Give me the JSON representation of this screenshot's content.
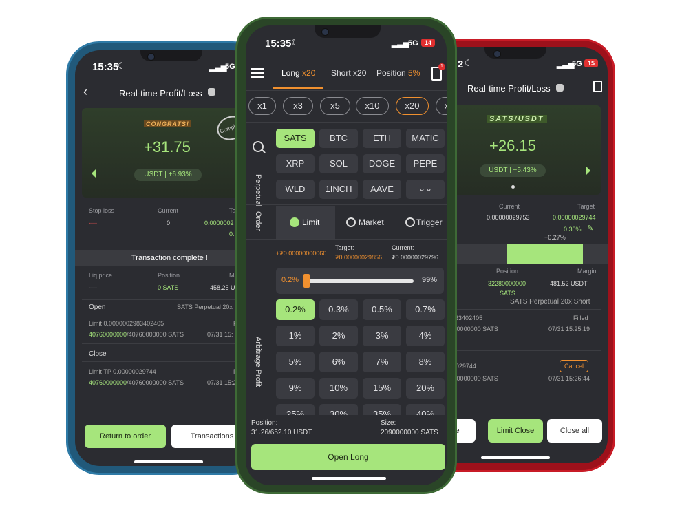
{
  "left": {
    "time": "15:35",
    "signal": "5G",
    "title": "Real-time Profit/Loss",
    "banner_text": "CONGRATS!",
    "stamp_text": "Complete",
    "profit": "+31.75",
    "pnl_badge": "USDT | +6.93%",
    "labels": {
      "stop_loss": "Stop loss",
      "current": "Current",
      "target": "Ta"
    },
    "values": {
      "stop_loss": "----",
      "current": "0",
      "target": "0.0000002",
      "target2": "0.3"
    },
    "tx_complete": "Transaction complete !",
    "pos_headers": {
      "liq": "Liq.price",
      "position": "Position",
      "margin": "Mar"
    },
    "pos_values": {
      "liq": "----",
      "position": "0 SATS",
      "margin": "458.25 U"
    },
    "open_label": "Open",
    "open_right": "SATS Perpetual 20x Sh",
    "open_limit": "Limit 0.0000002983402405",
    "open_status": "F",
    "open_filled_green": "40760000000",
    "open_filled_rest": "/40760000000 SATS",
    "open_time": "07/31 15:",
    "close_label": "Close",
    "close_limit": "Limit TP 0.00000029744",
    "close_status": "F",
    "close_filled_green": "40760000000",
    "close_filled_rest": "/40760000000 SATS",
    "close_time": "07/31 15:26",
    "btn_return": "Return to order",
    "btn_transactions": "Transactions"
  },
  "center": {
    "time": "15:35",
    "signal": "5G",
    "battery": "14",
    "notif_count": "1",
    "tabs": {
      "long": "Long",
      "long_lev": "x20",
      "short": "Short x20",
      "position": "Position",
      "position_pct": "5%"
    },
    "leverages": [
      "x1",
      "x3",
      "x5",
      "x10",
      "x20",
      "x"
    ],
    "selected_leverage": "x20",
    "perpetual_label": "Perpetual",
    "coins": [
      "SATS",
      "BTC",
      "ETH",
      "MATIC",
      "XRP",
      "SOL",
      "DOGE",
      "PEPE",
      "WLD",
      "1INCH",
      "AAVE"
    ],
    "selected_coin": "SATS",
    "order_label": "Order",
    "order_types": [
      "Limit",
      "Market",
      "Trigger"
    ],
    "selected_order": "Limit",
    "price_delta": "+₮0.00000000060",
    "target_label": "Target:",
    "target_value": "₮0.00000029856",
    "current_label": "Current:",
    "current_value": "₮0.00000029796",
    "slider_min": "0.2%",
    "slider_max": "99%",
    "slider_level": 0.0,
    "arb_label": "Arbitrage Profit",
    "profits": [
      "0.2%",
      "0.3%",
      "0.5%",
      "0.7%",
      "1%",
      "2%",
      "3%",
      "4%",
      "5%",
      "6%",
      "7%",
      "8%",
      "9%",
      "10%",
      "15%",
      "20%",
      "25%",
      "30%",
      "35%",
      "40%"
    ],
    "selected_profit": "0.2%",
    "position_label": "Position:",
    "position_value": "31.26/652.10 USDT",
    "size_label": "Size:",
    "size_value": "2090000000 SATS",
    "open_long": "Open Long"
  },
  "right": {
    "time": "2",
    "signal": "5G",
    "battery": "15",
    "title": "Real-time Profit/Loss",
    "pair": "SATS/USDT",
    "profit": "+26.15",
    "pnl_badge": "USDT | +5.43%",
    "labels": {
      "current": "Current",
      "target": "Target"
    },
    "values": {
      "left": "00000029753",
      "current": "0.00000029753",
      "target": "0.00000029744",
      "target_pct": "0.30%",
      "target_sub": "+0.27%"
    },
    "pos_headers": {
      "liq": "e",
      "position": "Position",
      "margin": "Margin"
    },
    "pos_values": {
      "liq": "031107",
      "position": "32280000000",
      "margin": "481.52 USDT"
    },
    "pos_coin": "SATS",
    "pos_desc": "SATS Perpetual 20x Short",
    "open_limit": "0000002983402405",
    "open_status": "Filled",
    "open_filled_green": "0000",
    "open_filled_rest": "/40760000000 SATS",
    "open_time": "07/31 15:25:19",
    "close_limit": "P 0.00000029744",
    "cancel": "Cancel",
    "close_filled_green": "0000",
    "close_filled_rest": "/40760000000 SATS",
    "close_time": "07/31 15:26:44",
    "btn_close": "n Close",
    "btn_limit_close": "Limit Close",
    "btn_close_all": "Close all"
  },
  "colors": {
    "accent": "#a6e57c",
    "orange": "#f0902f",
    "screen": "#2b2c31",
    "left_frame": "#2b6a8e",
    "center_frame": "#2f4a2c",
    "right_frame": "#b8141f"
  }
}
